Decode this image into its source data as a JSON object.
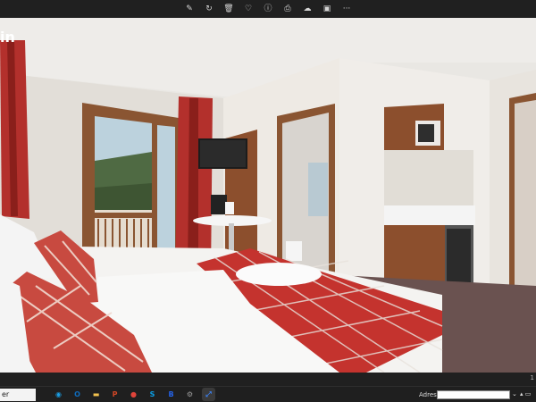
{
  "toolbar": {
    "icons": [
      "edit-icon",
      "rotate-icon",
      "delete-icon",
      "favorite-icon",
      "info-icon",
      "print-icon",
      "cloud-icon",
      "editor-icon",
      "more-icon"
    ],
    "glyphs": [
      "✎",
      "↻",
      "🗑",
      "♡",
      "ⓘ",
      "⎙",
      "☁",
      "▣",
      "···"
    ]
  },
  "photo": {
    "partial_title": "in",
    "subject": "hotel-room"
  },
  "statusbar": {
    "right_text": "1"
  },
  "taskbar": {
    "search_text": "er",
    "apps": [
      {
        "name": "edge-icon",
        "glyph": "◉",
        "color": "#1b9de2"
      },
      {
        "name": "outlook-icon",
        "glyph": "O",
        "color": "#0f6cbd"
      },
      {
        "name": "file-explorer-icon",
        "glyph": "▬",
        "color": "#f2c14e"
      },
      {
        "name": "powerpoint-icon",
        "glyph": "P",
        "color": "#d24726"
      },
      {
        "name": "chrome-icon",
        "glyph": "●",
        "color": "#e0443a"
      },
      {
        "name": "skype-icon",
        "glyph": "S",
        "color": "#0aa0e8"
      },
      {
        "name": "b-app-icon",
        "glyph": "B",
        "color": "#2463eb"
      },
      {
        "name": "settings-icon",
        "glyph": "⚙",
        "color": "#9a9a9a"
      },
      {
        "name": "photos-app-icon",
        "glyph": "⤢",
        "color": "#3b82f6"
      }
    ],
    "address_label": "Adresse",
    "address_value": "",
    "caret": "⌄",
    "sys_icons": "▴ ▭"
  }
}
